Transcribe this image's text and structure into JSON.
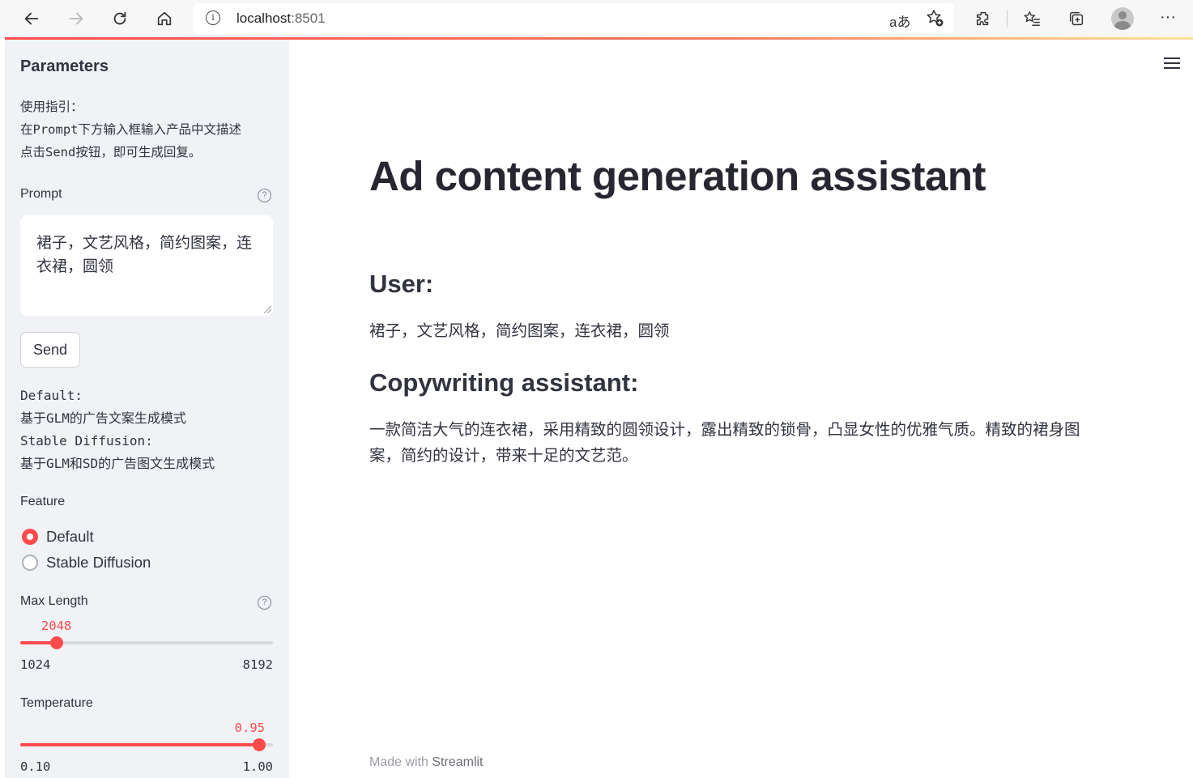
{
  "browser": {
    "url_host": "localhost",
    "url_port": ":8501",
    "read_aloud_glyph": "aあ"
  },
  "sidebar": {
    "title": "Parameters",
    "guide_lines": [
      "使用指引：",
      "在Prompt下方输入框输入产品中文描述",
      "点击Send按钮，即可生成回复。"
    ],
    "prompt_label": "Prompt",
    "prompt_value": "裙子，文艺风格，简约图案，连衣裙，圆领",
    "send_label": "Send",
    "mode_lines": [
      "Default:",
      "基于GLM的广告文案生成模式",
      "Stable Diffusion:",
      "基于GLM和SD的广告图文生成模式"
    ],
    "feature_label": "Feature",
    "feature_options": [
      "Default",
      "Stable Diffusion"
    ],
    "feature_selected": "Default",
    "max_length": {
      "label": "Max Length",
      "value": "2048",
      "min": "1024",
      "max": "8192",
      "fraction": 0.1429
    },
    "temperature": {
      "label": "Temperature",
      "value": "0.95",
      "min": "0.10",
      "max": "1.00",
      "fraction": 0.9444
    }
  },
  "main": {
    "title": "Ad content generation assistant",
    "user_heading": "User:",
    "user_text": "裙子，文艺风格，简约图案，连衣裙，圆领",
    "assistant_heading": "Copywriting assistant:",
    "assistant_text": "一款简洁大气的连衣裙，采用精致的圆领设计，露出精致的锁骨，凸显女性的优雅气质。精致的裙身图案，简约的设计，带来十足的文艺范。"
  },
  "footer": {
    "prefix": "Made with ",
    "brand": "Streamlit"
  },
  "colors": {
    "accent": "#ff4b4b",
    "sidebar_bg": "#f0f2f6",
    "text": "#31333f"
  },
  "icons": [
    "back-arrow-icon",
    "forward-arrow-icon",
    "refresh-icon",
    "home-icon",
    "info-icon",
    "read-aloud-icon",
    "add-favorite-icon",
    "extensions-icon",
    "favorites-icon",
    "collections-icon",
    "profile-avatar-icon",
    "more-icon",
    "help-icon",
    "hamburger-menu-icon"
  ]
}
